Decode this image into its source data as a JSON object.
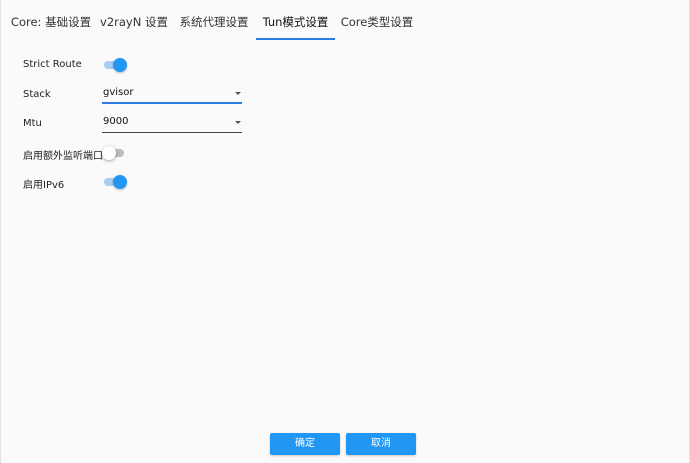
{
  "tabs": [
    {
      "label": "Core: 基础设置"
    },
    {
      "label": "v2rayN 设置"
    },
    {
      "label": "系统代理设置"
    },
    {
      "label": "Tun模式设置"
    },
    {
      "label": "Core类型设置"
    }
  ],
  "active_tab": "Tun模式设置",
  "form": {
    "strict_route": {
      "label": "Strict Route",
      "enabled": true
    },
    "stack": {
      "label": "Stack",
      "value": "gvisor"
    },
    "mtu": {
      "label": "Mtu",
      "value": "9000"
    },
    "extra_listen_port": {
      "label": "启用额外监听端口",
      "enabled": false
    },
    "ipv6": {
      "label": "启用IPv6",
      "enabled": true
    }
  },
  "buttons": {
    "ok": "确定",
    "cancel": "取消"
  },
  "colors": {
    "accent": "#2196f3",
    "track_on": "#aacdf2",
    "track_off": "#bdbdbd",
    "tab_indicator": "#2d7be0"
  }
}
